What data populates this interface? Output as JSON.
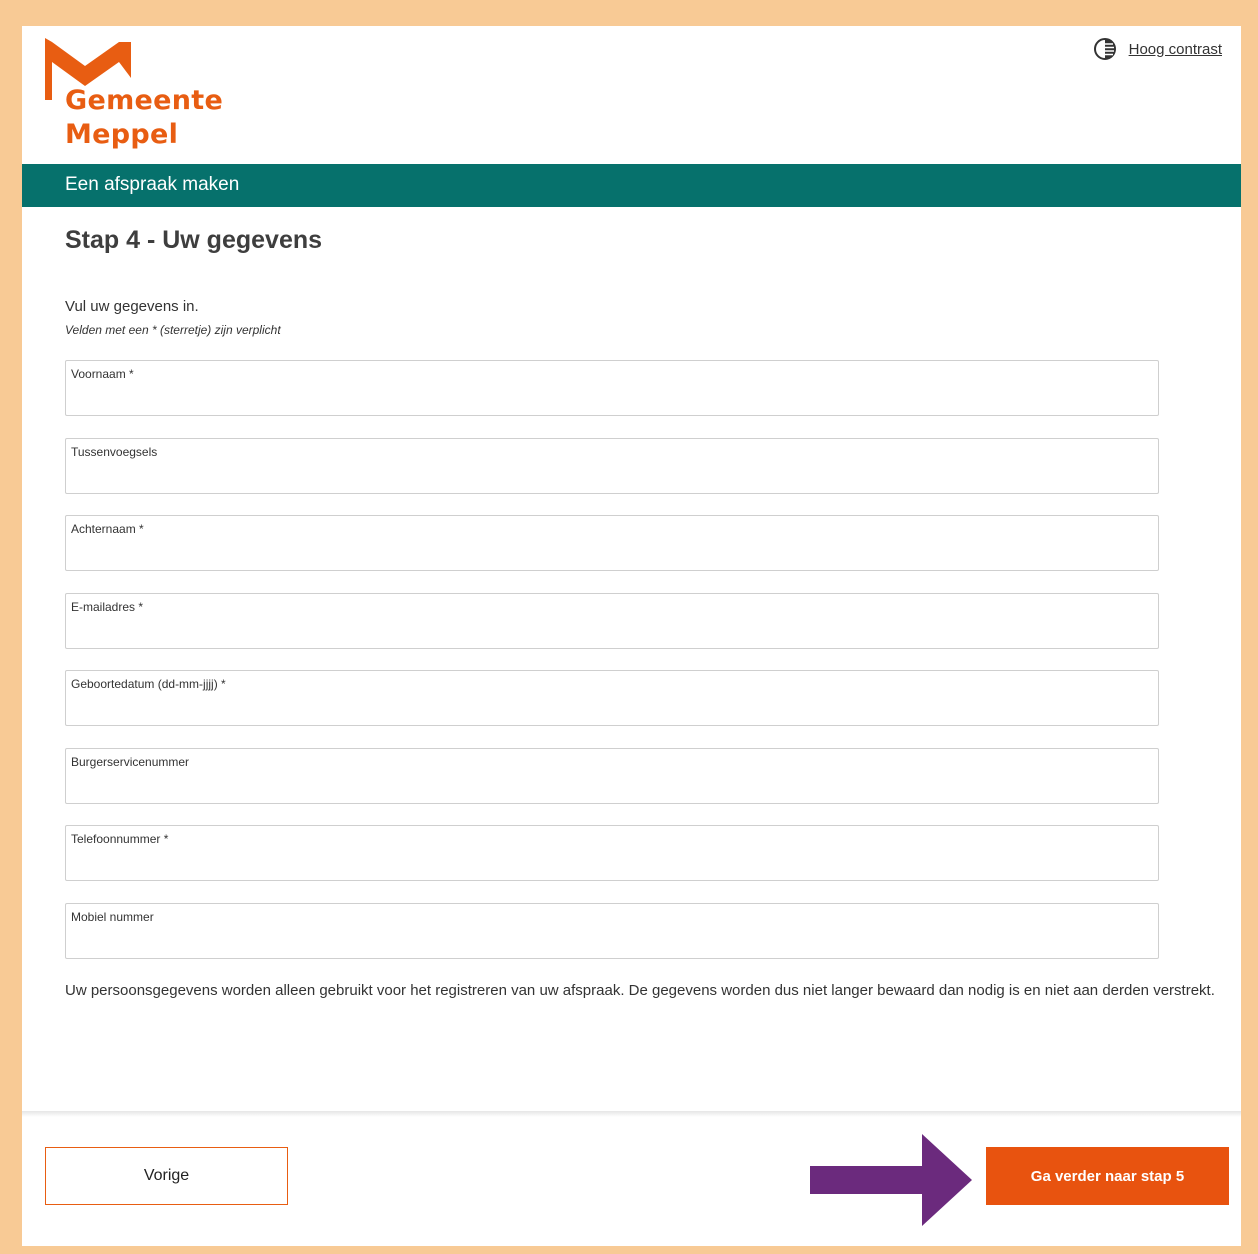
{
  "header": {
    "logo_line1": "Gemeente",
    "logo_line2": "Meppel",
    "contrast_link": "Hoog contrast"
  },
  "banner": {
    "title": "Een afspraak maken"
  },
  "page": {
    "heading": "Stap 4 - Uw gegevens",
    "intro": "Vul uw gegevens in.",
    "required_note": "Velden met een * (sterretje) zijn verplicht"
  },
  "form": {
    "fields": [
      {
        "label": "Voornaam *",
        "value": ""
      },
      {
        "label": "Tussenvoegsels",
        "value": ""
      },
      {
        "label": "Achternaam *",
        "value": ""
      },
      {
        "label": "E-mailadres *",
        "value": ""
      },
      {
        "label": "Geboortedatum (dd-mm-jjjj) *",
        "value": ""
      },
      {
        "label": "Burgerservicenummer",
        "value": ""
      },
      {
        "label": "Telefoonnummer *",
        "value": ""
      },
      {
        "label": "Mobiel nummer",
        "value": ""
      }
    ]
  },
  "privacy_text": "Uw persoonsgegevens worden alleen gebruikt voor het registreren van uw afspraak. De gegevens worden dus niet langer bewaard dan nodig is en niet aan derden verstrekt.",
  "footer": {
    "prev_label": "Vorige",
    "next_label": "Ga verder naar stap 5"
  },
  "colors": {
    "brand_orange": "#e8530f",
    "banner_teal": "#06716c",
    "page_border": "#f8ca95",
    "annotation_arrow": "#6b2a7d"
  }
}
